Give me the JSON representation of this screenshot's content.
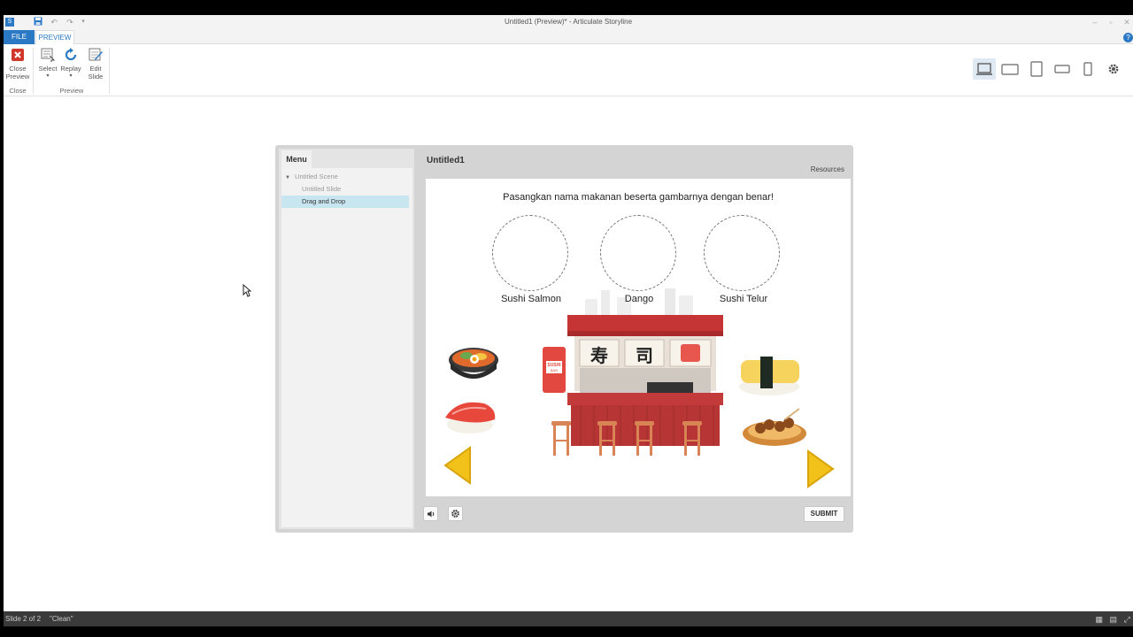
{
  "window": {
    "title": "Untitled1 (Preview)* - Articulate Storyline"
  },
  "ribbon": {
    "tabs": [
      "FILE",
      "PREVIEW"
    ],
    "buttons": {
      "close_preview": "Close Preview",
      "select": "Select",
      "replay": "Replay",
      "edit_slide": "Edit Slide"
    },
    "groups": {
      "close": "Close",
      "preview": "Preview"
    },
    "help": "?"
  },
  "status": {
    "slide": "Slide 2 of 2",
    "theme": "\"Clean\""
  },
  "player": {
    "menu_tab": "Menu",
    "menu": {
      "scene": "Untitled Scene",
      "slide1": "Untitled Slide",
      "slide2": "Drag and Drop"
    },
    "slide_title": "Untitled1",
    "resources": "Resources",
    "submit": "SUBMIT"
  },
  "slide": {
    "instruction": "Pasangkan nama makanan beserta gambarnya dengan benar!",
    "targets": [
      "Sushi Salmon",
      "Dango",
      "Sushi Telur"
    ],
    "sign": {
      "kanji1": "寿",
      "kanji2": "司",
      "banner": "SUSHI",
      "banner_sub": "BAR"
    }
  },
  "colors": {
    "accent": "#2b79c4",
    "stall_red": "#d13b3b",
    "arrow_gold": "#f2c21b",
    "menu_selected": "#c8e6f0"
  }
}
